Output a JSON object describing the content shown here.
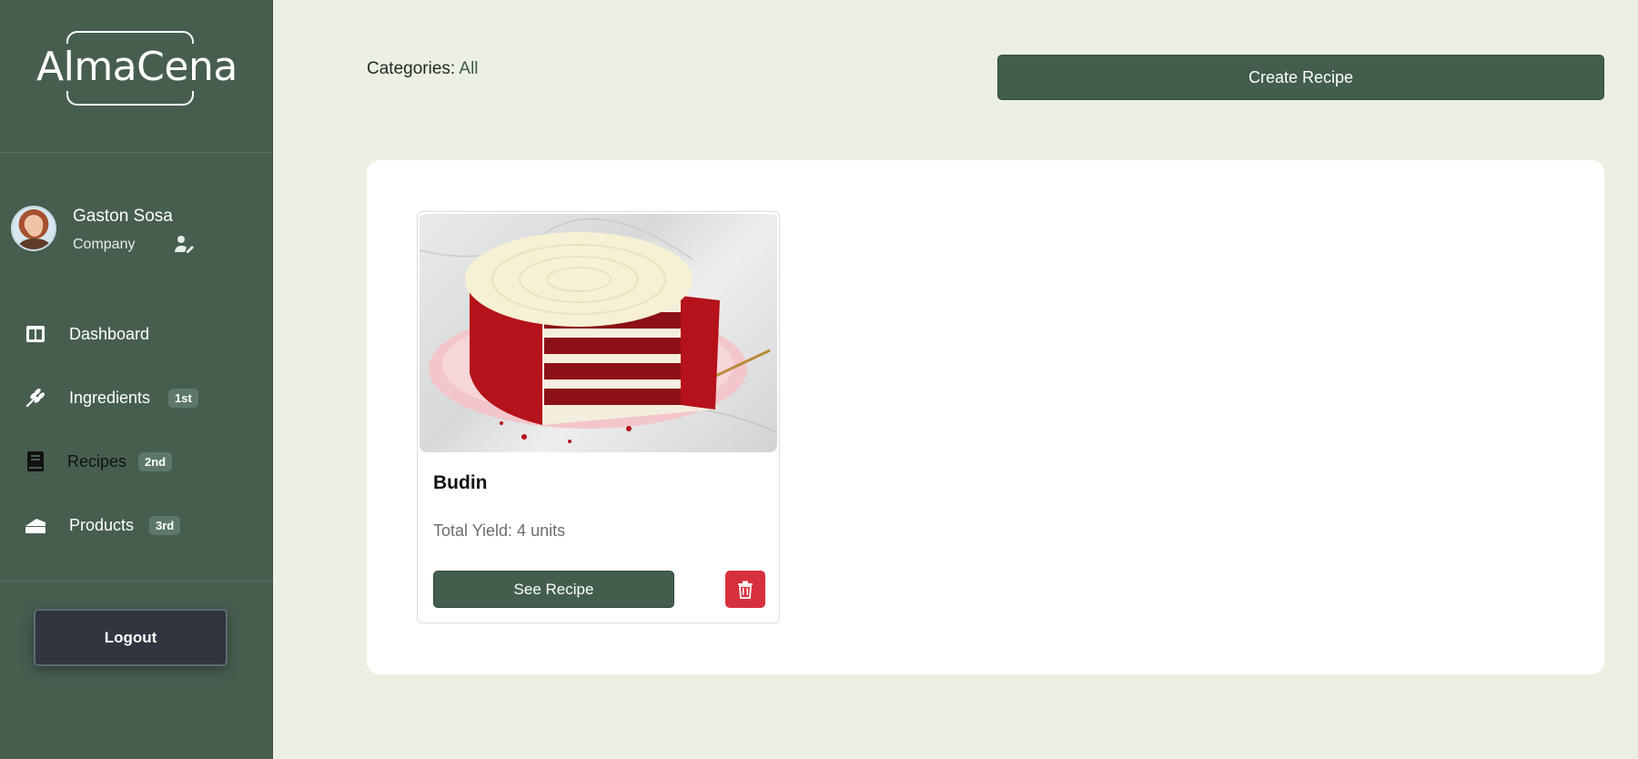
{
  "sidebar": {
    "logo": "AlmaCena",
    "user": {
      "name": "Gaston Sosa",
      "role": "Company",
      "edit_icon": "user-edit-icon",
      "avatar": "avatar"
    },
    "nav": [
      {
        "label": "Dashboard",
        "icon": "dashboard-icon",
        "badge": ""
      },
      {
        "label": "Ingredients",
        "icon": "wheat-icon",
        "badge": "1st"
      },
      {
        "label": "Recipes",
        "icon": "book-icon",
        "badge": "2nd"
      },
      {
        "label": "Products",
        "icon": "cake-icon",
        "badge": "3rd"
      }
    ],
    "logout_label": "Logout"
  },
  "main": {
    "categories_label": "Categories:",
    "categories_value": "All",
    "create_button": "Create Recipe",
    "recipes": [
      {
        "title": "Budin",
        "yield": "Total Yield: 4 units",
        "see_button": "See Recipe",
        "delete_icon": "trash-icon"
      }
    ]
  },
  "colors": {
    "sidebar_bg": "#475e4f",
    "page_bg": "#ebf0e3",
    "primary_button": "#435e4d",
    "danger": "#d7303d",
    "logout_bg": "#30353f"
  }
}
